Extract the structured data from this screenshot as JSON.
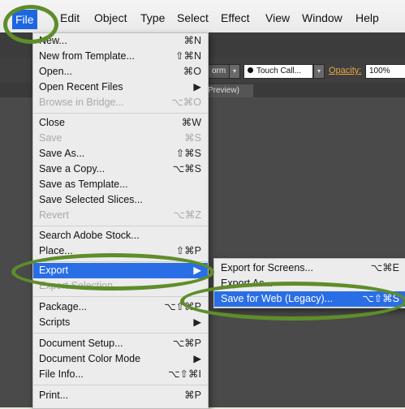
{
  "menubar": {
    "items": [
      "File",
      "Edit",
      "Object",
      "Type",
      "Select",
      "Effect",
      "View",
      "Window",
      "Help"
    ]
  },
  "control_bar": {
    "transform_label": "orm",
    "brush_label": "Touch Call...",
    "opacity_label": "Opacity:",
    "opacity_value": "100%"
  },
  "document_tab": {
    "label": "Preview)"
  },
  "file_menu": {
    "items": [
      {
        "label": "New...",
        "shortcut": "⌘N",
        "enabled": true
      },
      {
        "label": "New from Template...",
        "shortcut": "⇧⌘N",
        "enabled": true
      },
      {
        "label": "Open...",
        "shortcut": "⌘O",
        "enabled": true
      },
      {
        "label": "Open Recent Files",
        "shortcut": "▶",
        "enabled": true
      },
      {
        "label": "Browse in Bridge...",
        "shortcut": "⌥⌘O",
        "enabled": false
      },
      {
        "label": "Close",
        "shortcut": "⌘W",
        "enabled": true
      },
      {
        "label": "Save",
        "shortcut": "⌘S",
        "enabled": false
      },
      {
        "label": "Save As...",
        "shortcut": "⇧⌘S",
        "enabled": true
      },
      {
        "label": "Save a Copy...",
        "shortcut": "⌥⌘S",
        "enabled": true
      },
      {
        "label": "Save as Template...",
        "shortcut": "",
        "enabled": true
      },
      {
        "label": "Save Selected Slices...",
        "shortcut": "",
        "enabled": true
      },
      {
        "label": "Revert",
        "shortcut": "⌥⌘Z",
        "enabled": false
      },
      {
        "label": "Search Adobe Stock...",
        "shortcut": "",
        "enabled": true
      },
      {
        "label": "Place...",
        "shortcut": "⇧⌘P",
        "enabled": true
      },
      {
        "label": "Export",
        "shortcut": "▶",
        "enabled": true,
        "selected": true
      },
      {
        "label": "Export Selection...",
        "shortcut": "",
        "enabled": false
      },
      {
        "label": "Package...",
        "shortcut": "⌥⇧⌘P",
        "enabled": true
      },
      {
        "label": "Scripts",
        "shortcut": "▶",
        "enabled": true
      },
      {
        "label": "Document Setup...",
        "shortcut": "⌥⌘P",
        "enabled": true
      },
      {
        "label": "Document Color Mode",
        "shortcut": "▶",
        "enabled": true
      },
      {
        "label": "File Info...",
        "shortcut": "⌥⇧⌘I",
        "enabled": true
      },
      {
        "label": "Print...",
        "shortcut": "⌘P",
        "enabled": true
      }
    ]
  },
  "export_submenu": {
    "items": [
      {
        "label": "Export for Screens...",
        "shortcut": "⌥⌘E",
        "selected": false
      },
      {
        "label": "Export As...",
        "shortcut": "",
        "selected": false
      },
      {
        "label": "Save for Web (Legacy)...",
        "shortcut": "⌥⇧⌘S",
        "selected": true
      }
    ]
  },
  "colors": {
    "highlight": "#2a6ee6",
    "annotation_ring": "#5f8d2a",
    "opacity_label": "#e8a844"
  }
}
